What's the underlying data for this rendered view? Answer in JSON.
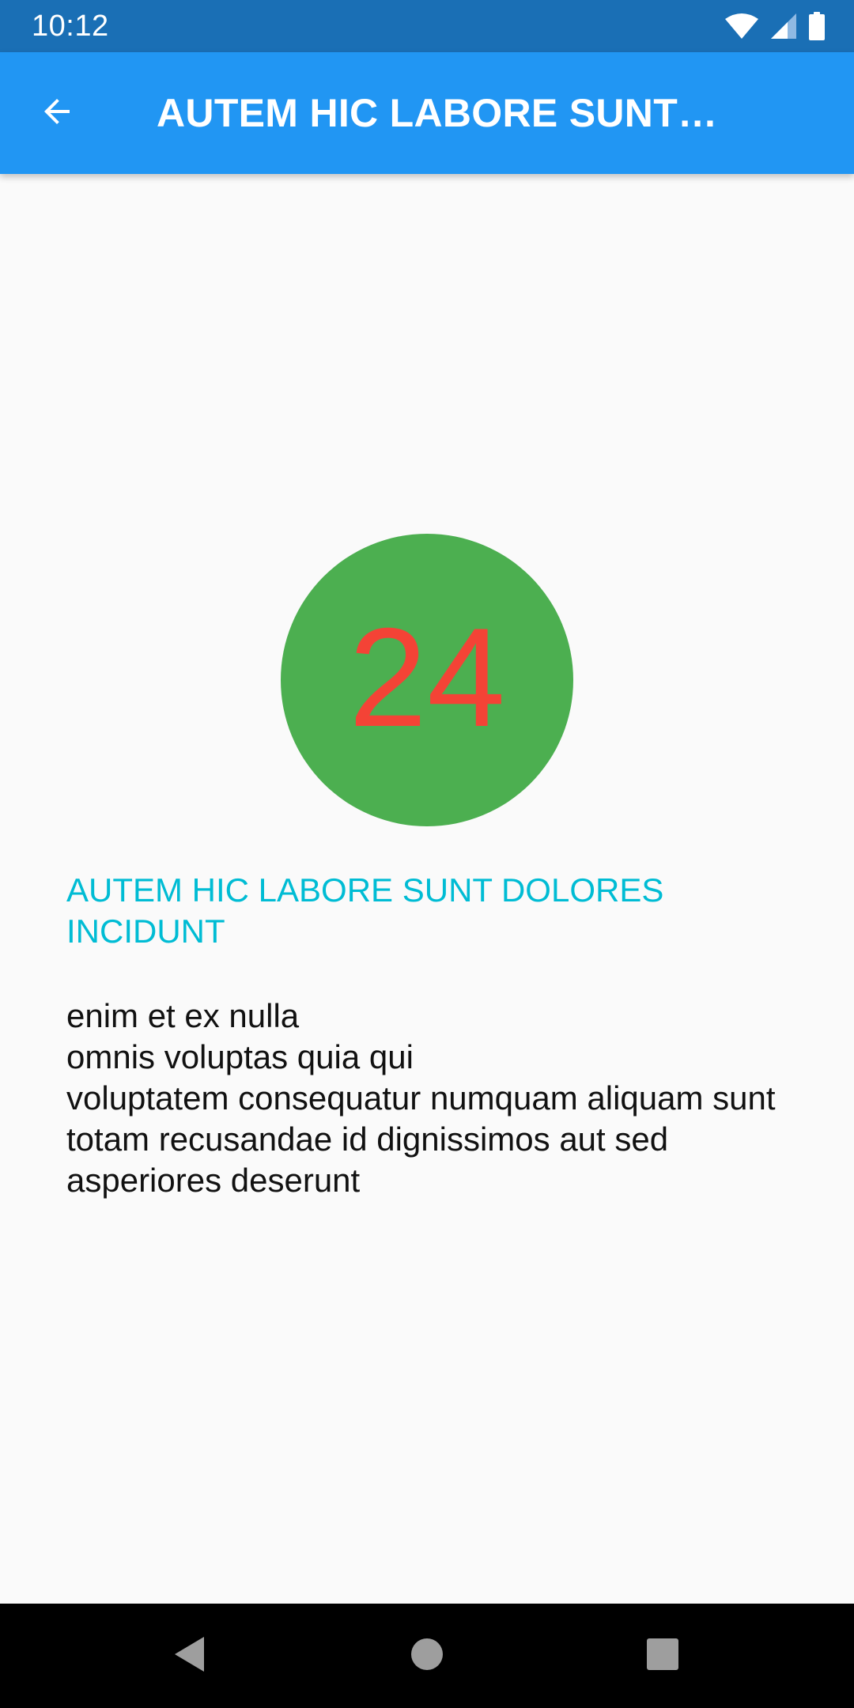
{
  "status_bar": {
    "time": "10:12",
    "icons": [
      "wifi-icon",
      "cell-signal-icon",
      "battery-icon"
    ]
  },
  "app_bar": {
    "back_icon": "arrow-back-icon",
    "title": "AUTEM HIC LABORE SUNT DOLORES INCIDUNT"
  },
  "detail": {
    "number": "24",
    "title": "AUTEM HIC LABORE SUNT DOLORES INCIDUNT",
    "body_lines": [
      "enim et ex nulla",
      "omnis voluptas quia qui",
      "voluptatem consequatur numquam aliquam sunt",
      "totam recusandae id dignissimos aut sed asperiores deserunt"
    ]
  },
  "nav_bar": {
    "icons": [
      "nav-back-icon",
      "nav-home-icon",
      "nav-recents-icon"
    ]
  },
  "colors": {
    "status_bar": "#1a6fb5",
    "app_bar": "#2196f3",
    "circle": "#4caf50",
    "number": "#f44336",
    "title": "#00bcd4",
    "background": "#fafafa"
  }
}
